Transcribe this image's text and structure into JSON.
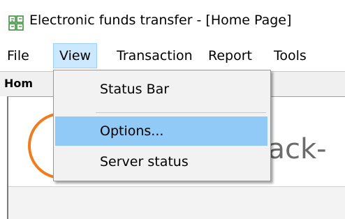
{
  "window": {
    "title": "Electronic funds transfer - [Home Page]",
    "icon": "transfer-app-icon"
  },
  "menubar": {
    "items": [
      {
        "label": "File"
      },
      {
        "label": "View"
      },
      {
        "label": "Transaction"
      },
      {
        "label": "Report"
      },
      {
        "label": "Tools"
      }
    ],
    "active": "View"
  },
  "tab": {
    "label": "Hom"
  },
  "content": {
    "heading": "Back-"
  },
  "dropdown": {
    "items": [
      {
        "label": "Status Bar"
      },
      {
        "label": "Options..."
      },
      {
        "label": "Server status"
      }
    ],
    "highlighted": "Options..."
  },
  "colors": {
    "accent_orange": "#f07c1e",
    "menu_active": "#cce8ff",
    "menu_hover": "#91c9f7"
  }
}
